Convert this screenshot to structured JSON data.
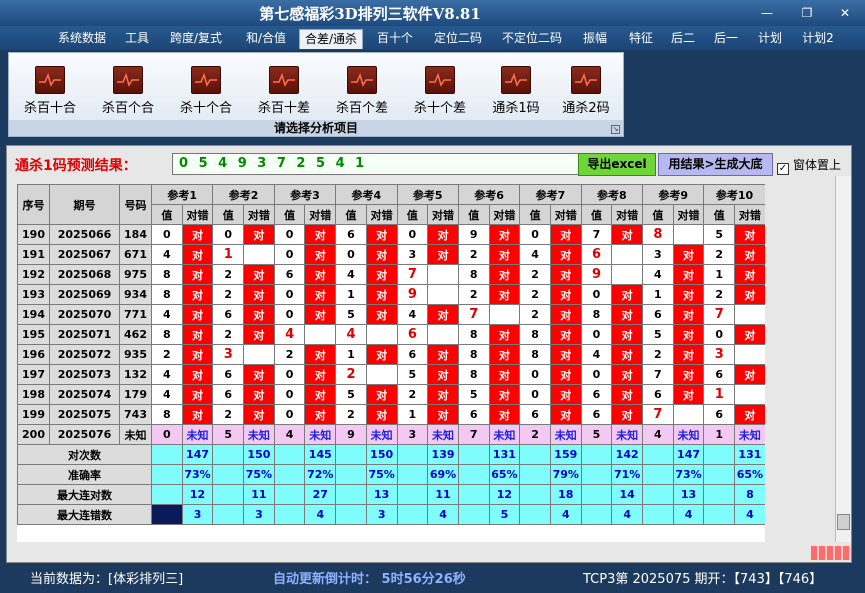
{
  "window": {
    "title": "第七感福彩3D排列三软件V8.81",
    "min_icon": "minimize-icon",
    "restore_icon": "restore-icon",
    "close_icon": "close-icon"
  },
  "menu": [
    "系统数据",
    "工具",
    "跨度/复式",
    "和/合值",
    "合差/通杀",
    "百十个",
    "定位二码",
    "不定位二码",
    "振幅",
    "特征",
    "后二",
    "后一",
    "计划",
    "计划2"
  ],
  "menu_active": "合差/通杀",
  "ribbon": {
    "buttons": [
      "杀百十合",
      "杀百个合",
      "杀十个合",
      "杀百十差",
      "杀百个差",
      "杀十个差",
      "通杀1码",
      "通杀2码"
    ],
    "group_label": "请选择分析项目"
  },
  "prediction": {
    "label": "通杀1码预测结果：",
    "value": "0 5 4 9 3 7 2 5 4 1",
    "excel_label": "导出excel",
    "generate_label": "用结果>生成大底",
    "topmost_label": "窗体置上",
    "topmost_checked": true
  },
  "table": {
    "head": {
      "seq": "序号",
      "period": "期号",
      "number": "号码",
      "val": "值",
      "result": "对错"
    },
    "refs": [
      "参考1",
      "参考2",
      "参考3",
      "参考4",
      "参考5",
      "参考6",
      "参考7",
      "参考8",
      "参考9",
      "参考10"
    ],
    "rows": [
      {
        "seq": "190",
        "period": "2025066",
        "num": "184",
        "cells": [
          [
            "0",
            "对"
          ],
          [
            "0",
            "对"
          ],
          [
            "0",
            "对"
          ],
          [
            "6",
            "对"
          ],
          [
            "0",
            "对"
          ],
          [
            "9",
            "对"
          ],
          [
            "0",
            "对"
          ],
          [
            "7",
            "对"
          ],
          [
            "8",
            ""
          ],
          [
            "5",
            "对"
          ]
        ]
      },
      {
        "seq": "191",
        "period": "2025067",
        "num": "671",
        "cells": [
          [
            "4",
            "对"
          ],
          [
            "1",
            ""
          ],
          [
            "0",
            "对"
          ],
          [
            "0",
            "对"
          ],
          [
            "3",
            "对"
          ],
          [
            "2",
            "对"
          ],
          [
            "4",
            "对"
          ],
          [
            "6",
            ""
          ],
          [
            "3",
            "对"
          ],
          [
            "2",
            "对"
          ]
        ]
      },
      {
        "seq": "192",
        "period": "2025068",
        "num": "975",
        "cells": [
          [
            "8",
            "对"
          ],
          [
            "2",
            "对"
          ],
          [
            "6",
            "对"
          ],
          [
            "4",
            "对"
          ],
          [
            "7",
            ""
          ],
          [
            "8",
            "对"
          ],
          [
            "2",
            "对"
          ],
          [
            "9",
            ""
          ],
          [
            "4",
            "对"
          ],
          [
            "1",
            "对"
          ]
        ]
      },
      {
        "seq": "193",
        "period": "2025069",
        "num": "934",
        "cells": [
          [
            "8",
            "对"
          ],
          [
            "2",
            "对"
          ],
          [
            "0",
            "对"
          ],
          [
            "1",
            "对"
          ],
          [
            "9",
            ""
          ],
          [
            "2",
            "对"
          ],
          [
            "2",
            "对"
          ],
          [
            "0",
            "对"
          ],
          [
            "1",
            "对"
          ],
          [
            "2",
            "对"
          ]
        ]
      },
      {
        "seq": "194",
        "period": "2025070",
        "num": "771",
        "cells": [
          [
            "4",
            "对"
          ],
          [
            "6",
            "对"
          ],
          [
            "0",
            "对"
          ],
          [
            "5",
            "对"
          ],
          [
            "4",
            "对"
          ],
          [
            "7",
            ""
          ],
          [
            "2",
            "对"
          ],
          [
            "8",
            "对"
          ],
          [
            "6",
            "对"
          ],
          [
            "7",
            ""
          ]
        ]
      },
      {
        "seq": "195",
        "period": "2025071",
        "num": "462",
        "cells": [
          [
            "8",
            "对"
          ],
          [
            "2",
            "对"
          ],
          [
            "4",
            ""
          ],
          [
            "4",
            ""
          ],
          [
            "6",
            ""
          ],
          [
            "8",
            "对"
          ],
          [
            "8",
            "对"
          ],
          [
            "0",
            "对"
          ],
          [
            "5",
            "对"
          ],
          [
            "0",
            "对"
          ]
        ]
      },
      {
        "seq": "196",
        "period": "2025072",
        "num": "935",
        "cells": [
          [
            "2",
            "对"
          ],
          [
            "3",
            ""
          ],
          [
            "2",
            "对"
          ],
          [
            "1",
            "对"
          ],
          [
            "6",
            "对"
          ],
          [
            "8",
            "对"
          ],
          [
            "8",
            "对"
          ],
          [
            "4",
            "对"
          ],
          [
            "2",
            "对"
          ],
          [
            "3",
            ""
          ]
        ]
      },
      {
        "seq": "197",
        "period": "2025073",
        "num": "132",
        "cells": [
          [
            "4",
            "对"
          ],
          [
            "6",
            "对"
          ],
          [
            "0",
            "对"
          ],
          [
            "2",
            ""
          ],
          [
            "5",
            "对"
          ],
          [
            "8",
            "对"
          ],
          [
            "0",
            "对"
          ],
          [
            "0",
            "对"
          ],
          [
            "7",
            "对"
          ],
          [
            "6",
            "对"
          ]
        ]
      },
      {
        "seq": "198",
        "period": "2025074",
        "num": "179",
        "cells": [
          [
            "4",
            "对"
          ],
          [
            "6",
            "对"
          ],
          [
            "0",
            "对"
          ],
          [
            "5",
            "对"
          ],
          [
            "2",
            "对"
          ],
          [
            "5",
            "对"
          ],
          [
            "0",
            "对"
          ],
          [
            "6",
            "对"
          ],
          [
            "6",
            "对"
          ],
          [
            "1",
            ""
          ]
        ]
      },
      {
        "seq": "199",
        "period": "2025075",
        "num": "743",
        "cells": [
          [
            "8",
            "对"
          ],
          [
            "2",
            "对"
          ],
          [
            "0",
            "对"
          ],
          [
            "2",
            "对"
          ],
          [
            "1",
            "对"
          ],
          [
            "6",
            "对"
          ],
          [
            "6",
            "对"
          ],
          [
            "6",
            "对"
          ],
          [
            "7",
            ""
          ],
          [
            "6",
            "对"
          ]
        ]
      },
      {
        "seq": "200",
        "period": "2025076",
        "num": "未知",
        "cells": [
          [
            "0",
            "未知"
          ],
          [
            "5",
            "未知"
          ],
          [
            "4",
            "未知"
          ],
          [
            "9",
            "未知"
          ],
          [
            "3",
            "未知"
          ],
          [
            "7",
            "未知"
          ],
          [
            "2",
            "未知"
          ],
          [
            "5",
            "未知"
          ],
          [
            "4",
            "未知"
          ],
          [
            "1",
            "未知"
          ]
        ]
      }
    ],
    "stats": [
      {
        "label": "对次数",
        "values": [
          "147",
          "150",
          "145",
          "150",
          "139",
          "131",
          "159",
          "142",
          "147",
          "131"
        ]
      },
      {
        "label": "准确率",
        "values": [
          "73%",
          "75%",
          "72%",
          "75%",
          "69%",
          "65%",
          "79%",
          "71%",
          "73%",
          "65%"
        ]
      },
      {
        "label": "最大连对数",
        "values": [
          "12",
          "11",
          "27",
          "13",
          "11",
          "12",
          "18",
          "14",
          "13",
          "8"
        ]
      },
      {
        "label": "最大连错数",
        "values": [
          "3",
          "3",
          "4",
          "3",
          "4",
          "5",
          "4",
          "4",
          "4",
          "4"
        ]
      }
    ]
  },
  "status": {
    "current": "当前数据为：[体彩排列三]",
    "countdown": "自动更新倒计时： 5时56分26秒",
    "draw": "TCP3第 2025075 期开：【743】【746】"
  }
}
